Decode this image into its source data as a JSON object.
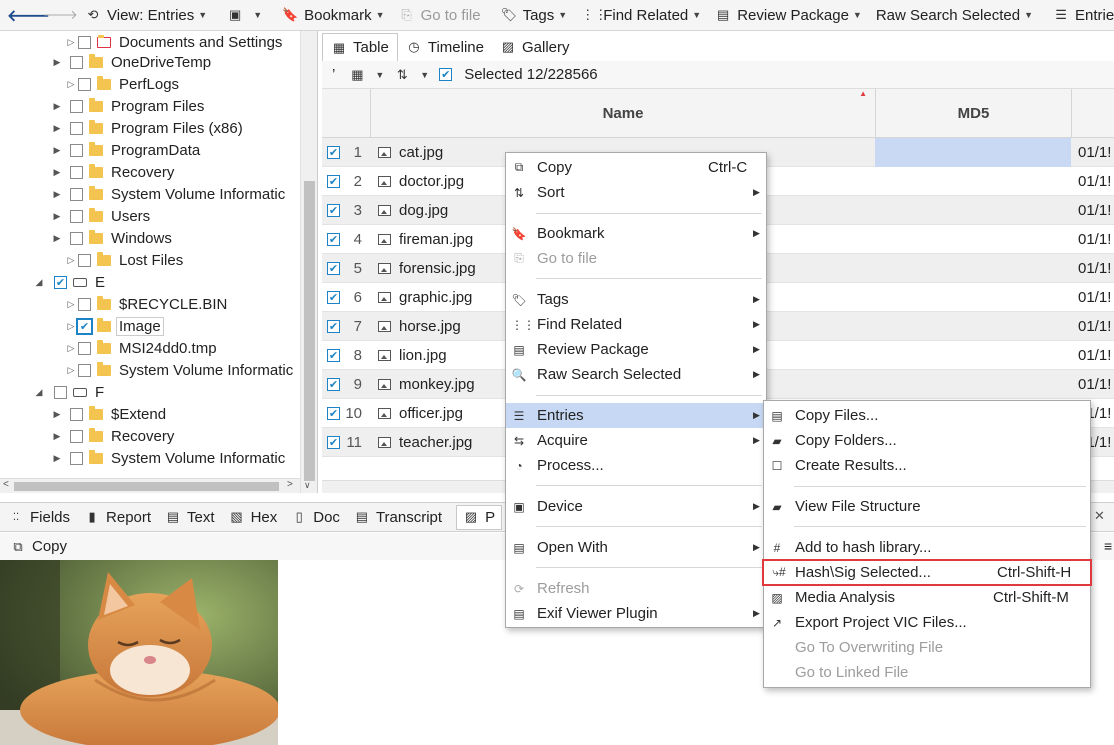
{
  "toolbar": {
    "view_label": "View: Entries",
    "bookmark": "Bookmark",
    "go_to_file": "Go to file",
    "tags": "Tags",
    "find_related": "Find Related",
    "review_package": "Review Package",
    "raw_search": "Raw Search Selected",
    "entries": "Entries"
  },
  "tree": {
    "items": [
      {
        "label": "Documents and Settings"
      },
      {
        "label": "OneDriveTemp"
      },
      {
        "label": "PerfLogs"
      },
      {
        "label": "Program Files"
      },
      {
        "label": "Program Files (x86)"
      },
      {
        "label": "ProgramData"
      },
      {
        "label": "Recovery"
      },
      {
        "label": "System Volume Informatic"
      },
      {
        "label": "Users"
      },
      {
        "label": "Windows"
      },
      {
        "label": "Lost Files"
      },
      {
        "label": "E"
      },
      {
        "label": "$RECYCLE.BIN"
      },
      {
        "label": "Image"
      },
      {
        "label": "MSI24dd0.tmp"
      },
      {
        "label": "System Volume Informatic"
      },
      {
        "label": "F"
      },
      {
        "label": "$Extend"
      },
      {
        "label": "Recovery"
      },
      {
        "label": "System Volume Informatic"
      }
    ]
  },
  "view_tabs": {
    "table": "Table",
    "timeline": "Timeline",
    "gallery": "Gallery"
  },
  "subbar": {
    "selected": "Selected 12/228566",
    "quote": "’"
  },
  "grid": {
    "columns": {
      "name": "Name",
      "md5": "MD5"
    },
    "rows": [
      {
        "n": "1",
        "name": "cat.jpg",
        "date": "01/1!"
      },
      {
        "n": "2",
        "name": "doctor.jpg",
        "date": "01/1!"
      },
      {
        "n": "3",
        "name": "dog.jpg",
        "date": "01/1!"
      },
      {
        "n": "4",
        "name": "fireman.jpg",
        "date": "01/1!"
      },
      {
        "n": "5",
        "name": "forensic.jpg",
        "date": "01/1!"
      },
      {
        "n": "6",
        "name": "graphic.jpg",
        "date": "01/1!"
      },
      {
        "n": "7",
        "name": "horse.jpg",
        "date": "01/1!"
      },
      {
        "n": "8",
        "name": "lion.jpg",
        "date": "01/1!"
      },
      {
        "n": "9",
        "name": "monkey.jpg",
        "date": "01/1!"
      },
      {
        "n": "10",
        "name": "officer.jpg",
        "date": "01/1!"
      },
      {
        "n": "11",
        "name": "teacher.jpg",
        "date": "01/1!"
      }
    ]
  },
  "bottom_tabs": {
    "fields": "Fields",
    "report": "Report",
    "text": "Text",
    "hex": "Hex",
    "doc": "Doc",
    "transcript": "Transcript",
    "preview": "P"
  },
  "copybar": {
    "copy": "Copy"
  },
  "context_menu": {
    "copy": "Copy",
    "copy_sc": "Ctrl-C",
    "sort": "Sort",
    "bookmark": "Bookmark",
    "go_to_file": "Go to file",
    "tags": "Tags",
    "find_related": "Find Related",
    "review_package": "Review Package",
    "raw_search": "Raw Search Selected",
    "entries": "Entries",
    "acquire": "Acquire",
    "process": "Process...",
    "device": "Device",
    "open_with": "Open With",
    "refresh": "Refresh",
    "exif": "Exif Viewer Plugin"
  },
  "submenu": {
    "copy_files": "Copy Files...",
    "copy_folders": "Copy Folders...",
    "create_results": "Create Results...",
    "view_file_structure": "View File Structure",
    "add_hash_library": "Add to hash library...",
    "hash_sig_selected": "Hash\\Sig Selected...",
    "hash_sig_sc": "Ctrl-Shift-H",
    "media_analysis": "Media Analysis",
    "media_analysis_sc": "Ctrl-Shift-M",
    "export_vic": "Export Project VIC Files...",
    "go_overwriting": "Go To Overwriting File",
    "go_linked": "Go to Linked File"
  }
}
